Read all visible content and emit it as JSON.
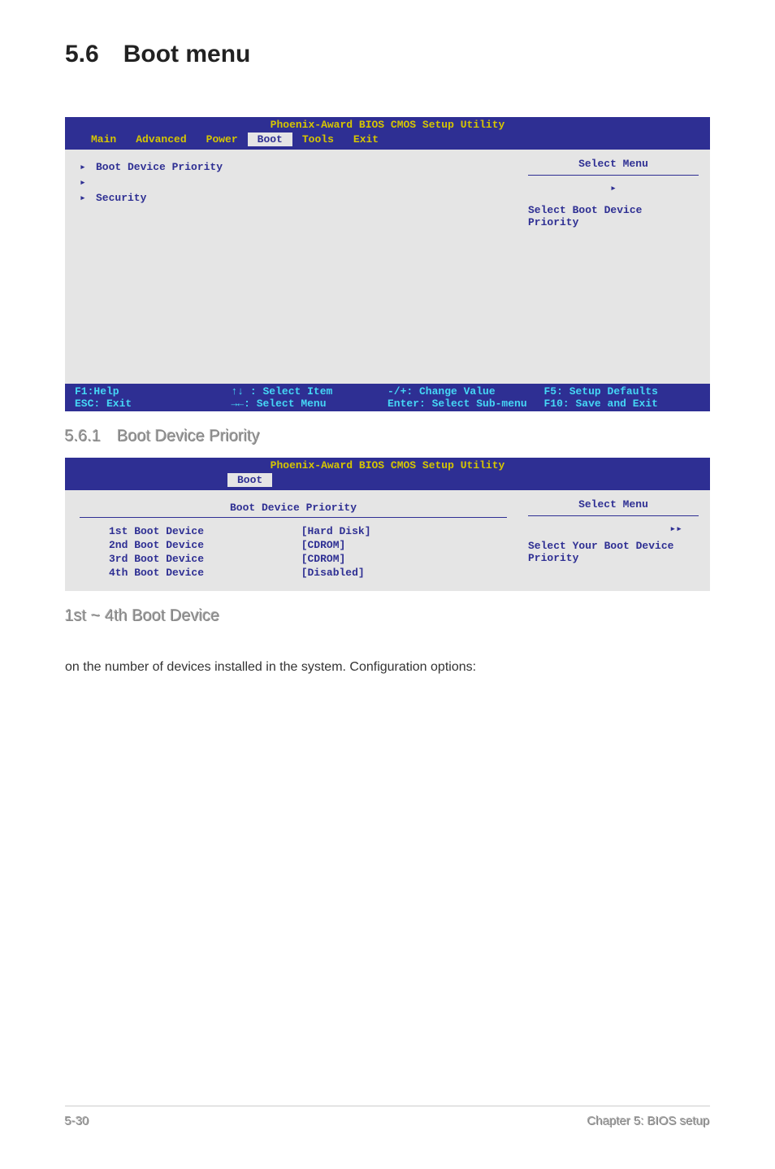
{
  "page": {
    "section_number": "5.6",
    "section_title": "Boot menu",
    "sub_number": "5.6.1",
    "sub_title": "Boot Device Priority",
    "sub2_title": "1st ~ 4th Boot Device",
    "body_text": "on the number of devices installed in the system. Configuration options:",
    "footer_left": "5-30",
    "footer_right": "Chapter 5: BIOS setup"
  },
  "bios1": {
    "title": "Phoenix-Award BIOS CMOS Setup Utility",
    "tabs": [
      "Main",
      "Advanced",
      "Power",
      "Boot",
      "Tools",
      "Exit"
    ],
    "active_tab": "Boot",
    "items": [
      "Boot Device Priority",
      "Security"
    ],
    "select_menu": "Select Menu",
    "help_text": "Select Boot Device Priority",
    "footer": {
      "l1": "F1:Help",
      "l2": "ESC: Exit",
      "c1": "↑↓ : Select Item",
      "c2": "→←: Select Menu",
      "r1": "-/+: Change Value",
      "r2": "Enter: Select Sub-menu",
      "f1": "F5: Setup Defaults",
      "f2": "F10: Save and Exit"
    }
  },
  "bios2": {
    "title": "Phoenix-Award BIOS CMOS Setup Utility",
    "tab": "Boot",
    "header": "Boot Device Priority",
    "rows": [
      {
        "label": "1st Boot Device",
        "value": "[Hard Disk]"
      },
      {
        "label": "2nd Boot Device",
        "value": "[CDROM]"
      },
      {
        "label": "3rd Boot Device",
        "value": "[CDROM]"
      },
      {
        "label": "4th Boot Device",
        "value": "[Disabled]"
      }
    ],
    "select_menu": "Select Menu",
    "help_text": "Select Your Boot Device Priority"
  }
}
